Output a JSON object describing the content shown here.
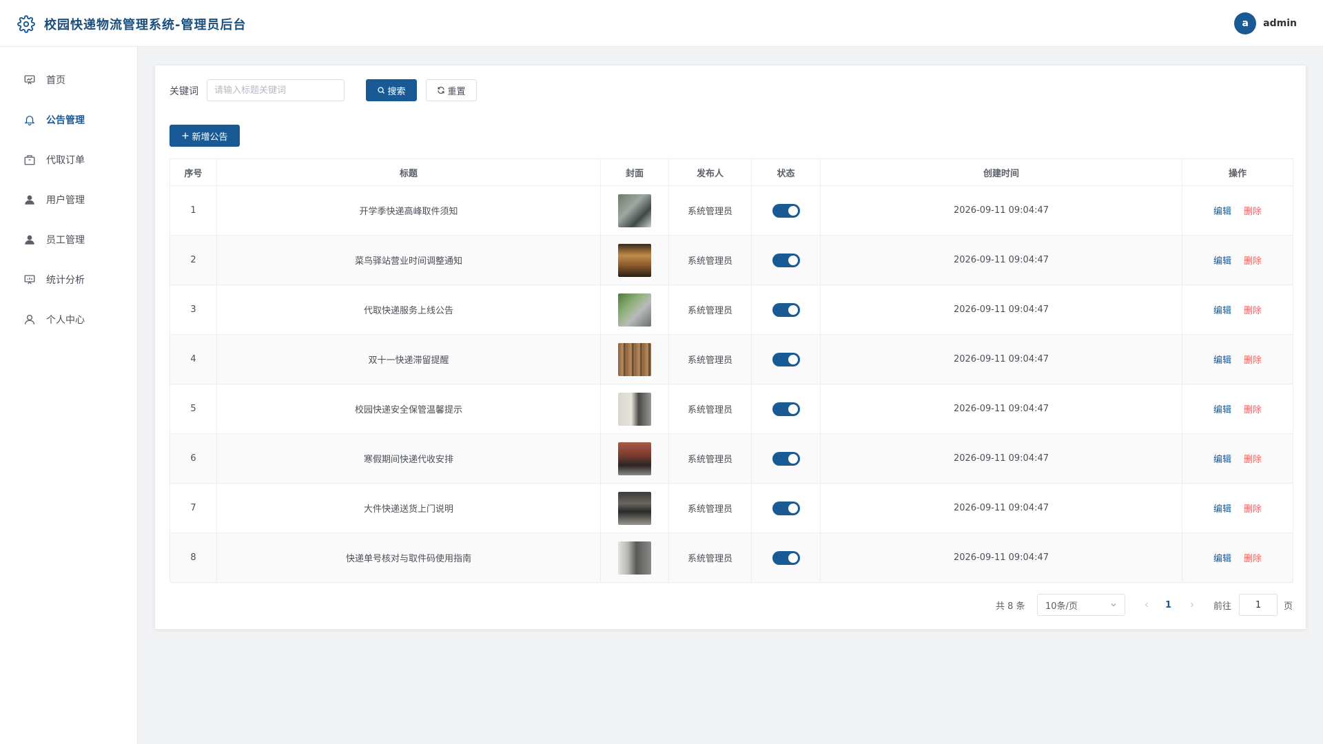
{
  "header": {
    "title": "校园快递物流管理系统-管理员后台",
    "user_initial": "a",
    "user_name": "admin"
  },
  "sidebar": {
    "items": [
      {
        "label": "首页",
        "icon": "dashboard-icon",
        "active": false
      },
      {
        "label": "公告管理",
        "icon": "bell-icon",
        "active": true
      },
      {
        "label": "代取订单",
        "icon": "package-icon",
        "active": false
      },
      {
        "label": "用户管理",
        "icon": "user-icon",
        "active": false
      },
      {
        "label": "员工管理",
        "icon": "user-icon",
        "active": false
      },
      {
        "label": "统计分析",
        "icon": "chart-board-icon",
        "active": false
      },
      {
        "label": "个人中心",
        "icon": "user-outline-icon",
        "active": false
      }
    ]
  },
  "search": {
    "label": "关键词",
    "placeholder": "请输入标题关键词",
    "value": "",
    "search_label": "搜索",
    "reset_label": "重置"
  },
  "toolbar": {
    "add_label": "新增公告"
  },
  "table": {
    "columns": [
      "序号",
      "标题",
      "封面",
      "发布人",
      "状态",
      "创建时间",
      "操作"
    ],
    "edit_label": "编辑",
    "delete_label": "删除",
    "rows": [
      {
        "index": "1",
        "title": "开学季快递高峰取件须知",
        "publisher": "系统管理员",
        "status_on": true,
        "created": "2026-09-11 09:04:47"
      },
      {
        "index": "2",
        "title": "菜鸟驿站营业时间调整通知",
        "publisher": "系统管理员",
        "status_on": true,
        "created": "2026-09-11 09:04:47"
      },
      {
        "index": "3",
        "title": "代取快递服务上线公告",
        "publisher": "系统管理员",
        "status_on": true,
        "created": "2026-09-11 09:04:47"
      },
      {
        "index": "4",
        "title": "双十一快递滞留提醒",
        "publisher": "系统管理员",
        "status_on": true,
        "created": "2026-09-11 09:04:47"
      },
      {
        "index": "5",
        "title": "校园快递安全保管温馨提示",
        "publisher": "系统管理员",
        "status_on": true,
        "created": "2026-09-11 09:04:47"
      },
      {
        "index": "6",
        "title": "寒假期间快递代收安排",
        "publisher": "系统管理员",
        "status_on": true,
        "created": "2026-09-11 09:04:47"
      },
      {
        "index": "7",
        "title": "大件快递送货上门说明",
        "publisher": "系统管理员",
        "status_on": true,
        "created": "2026-09-11 09:04:47"
      },
      {
        "index": "8",
        "title": "快递单号核对与取件码使用指南",
        "publisher": "系统管理员",
        "status_on": true,
        "created": "2026-09-11 09:04:47"
      }
    ]
  },
  "pagination": {
    "total_label": "共 8 条",
    "page_size": "10条/页",
    "current_page": "1",
    "goto_label": "前往",
    "goto_value": "1",
    "page_suffix": "页"
  },
  "colors": {
    "primary": "#1a5a94",
    "danger": "#f06565",
    "page_bg": "#f2f3f5"
  }
}
